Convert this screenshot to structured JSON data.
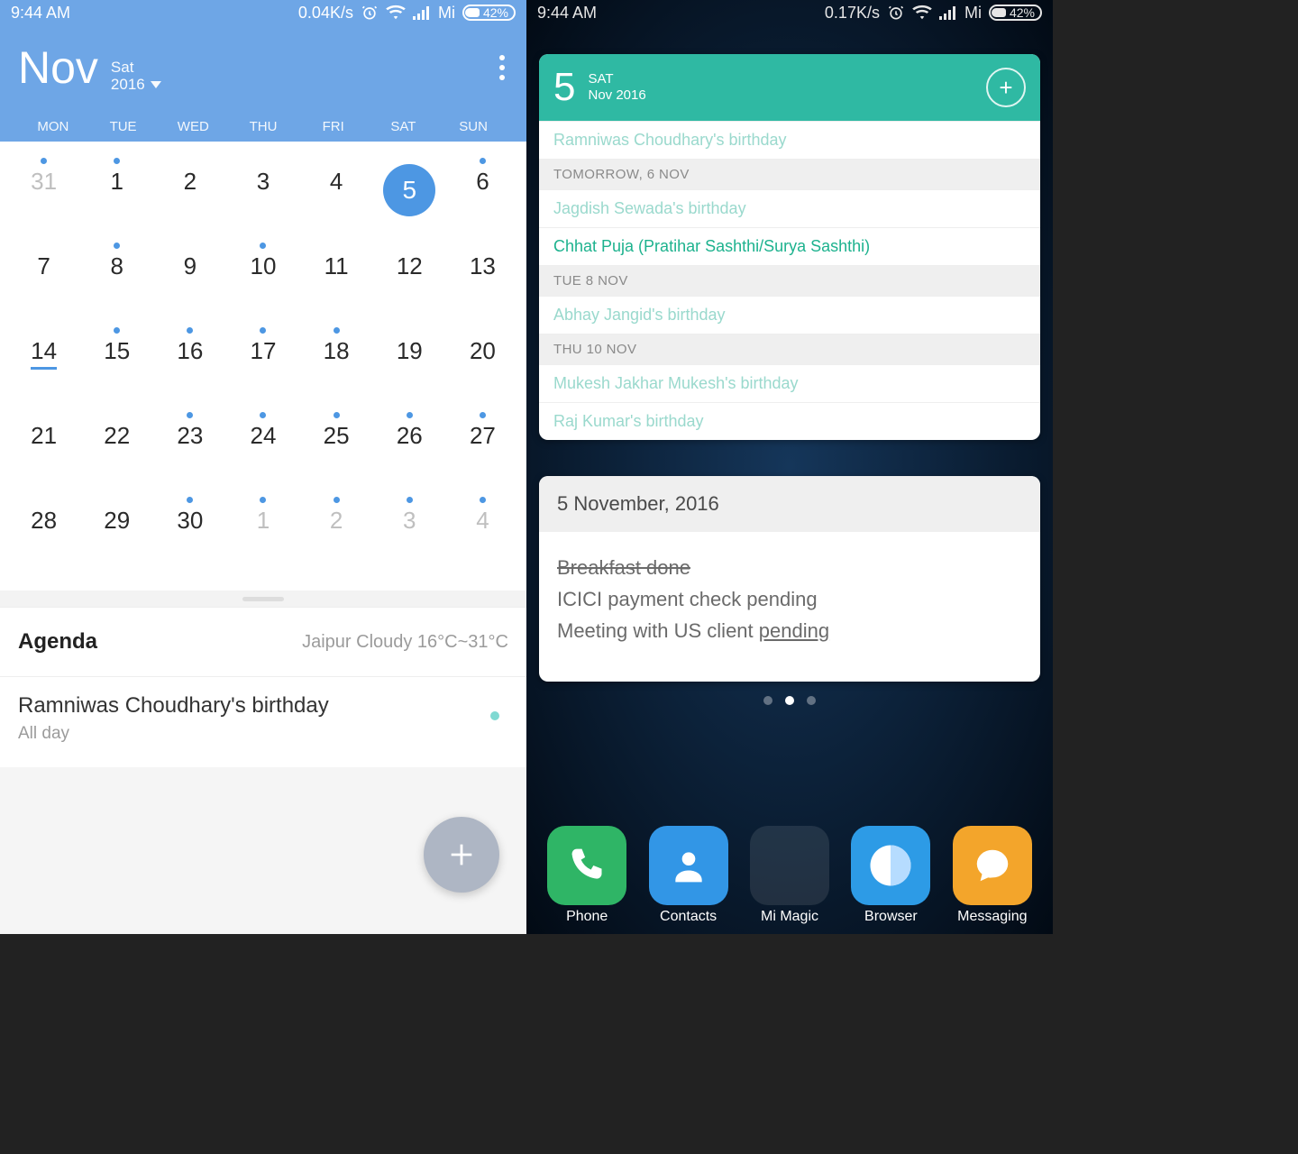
{
  "left": {
    "status": {
      "time": "9:44 AM",
      "net": "0.04K/s",
      "carrier": "Mi",
      "battery": "42%"
    },
    "header": {
      "month": "Nov",
      "dow": "Sat",
      "year": "2016"
    },
    "dow": [
      "MON",
      "TUE",
      "WED",
      "THU",
      "FRI",
      "SAT",
      "SUN"
    ],
    "weeks": [
      [
        {
          "n": "31",
          "muted": true,
          "dot": true
        },
        {
          "n": "1",
          "dot": true
        },
        {
          "n": "2"
        },
        {
          "n": "3"
        },
        {
          "n": "4"
        },
        {
          "n": "5",
          "selected": true,
          "dot": true
        },
        {
          "n": "6",
          "dot": true
        }
      ],
      [
        {
          "n": "7"
        },
        {
          "n": "8",
          "dot": true
        },
        {
          "n": "9"
        },
        {
          "n": "10",
          "dot": true
        },
        {
          "n": "11"
        },
        {
          "n": "12"
        },
        {
          "n": "13"
        }
      ],
      [
        {
          "n": "14",
          "underline": true
        },
        {
          "n": "15",
          "dot": true
        },
        {
          "n": "16",
          "dot": true
        },
        {
          "n": "17",
          "dot": true
        },
        {
          "n": "18",
          "dot": true
        },
        {
          "n": "19"
        },
        {
          "n": "20"
        }
      ],
      [
        {
          "n": "21"
        },
        {
          "n": "22"
        },
        {
          "n": "23",
          "dot": true
        },
        {
          "n": "24",
          "dot": true
        },
        {
          "n": "25",
          "dot": true
        },
        {
          "n": "26",
          "dot": true
        },
        {
          "n": "27",
          "dot": true
        }
      ],
      [
        {
          "n": "28"
        },
        {
          "n": "29"
        },
        {
          "n": "30",
          "dot": true
        },
        {
          "n": "1",
          "muted": true,
          "dot": true
        },
        {
          "n": "2",
          "muted": true,
          "dot": true
        },
        {
          "n": "3",
          "muted": true,
          "dot": true
        },
        {
          "n": "4",
          "muted": true,
          "dot": true
        }
      ]
    ],
    "agenda": {
      "title": "Agenda",
      "weather": "Jaipur  Cloudy  16°C~31°C",
      "event": "Ramniwas Choudhary's birthday",
      "allday": "All day"
    }
  },
  "right": {
    "status": {
      "time": "9:44 AM",
      "net": "0.17K/s",
      "carrier": "Mi",
      "battery": "42%"
    },
    "calwidget": {
      "daynum": "5",
      "dow": "SAT",
      "monthyear": "Nov 2016",
      "rows": [
        {
          "type": "event-light",
          "text": "Ramniwas Choudhary's birthday"
        },
        {
          "type": "section",
          "text": "TOMORROW, 6 NOV"
        },
        {
          "type": "event-light",
          "text": "Jagdish Sewada's birthday"
        },
        {
          "type": "event-strong",
          "text": "Chhat Puja (Pratihar Sashthi/Surya Sashthi)"
        },
        {
          "type": "section",
          "text": "TUE 8 NOV"
        },
        {
          "type": "event-light",
          "text": "Abhay Jangid's birthday"
        },
        {
          "type": "section",
          "text": "THU 10 NOV"
        },
        {
          "type": "event-light",
          "text": "Mukesh Jakhar Mukesh's birthday"
        },
        {
          "type": "event-light",
          "text": "Raj Kumar's birthday"
        }
      ]
    },
    "notes": {
      "date": "5 November, 2016",
      "line1": "Breakfast done",
      "line2": "ICICI payment check pending",
      "line3a": "Meeting with US client ",
      "line3b": "pending"
    },
    "dock": [
      "Phone",
      "Contacts",
      "Mi Magic",
      "Browser",
      "Messaging"
    ]
  }
}
